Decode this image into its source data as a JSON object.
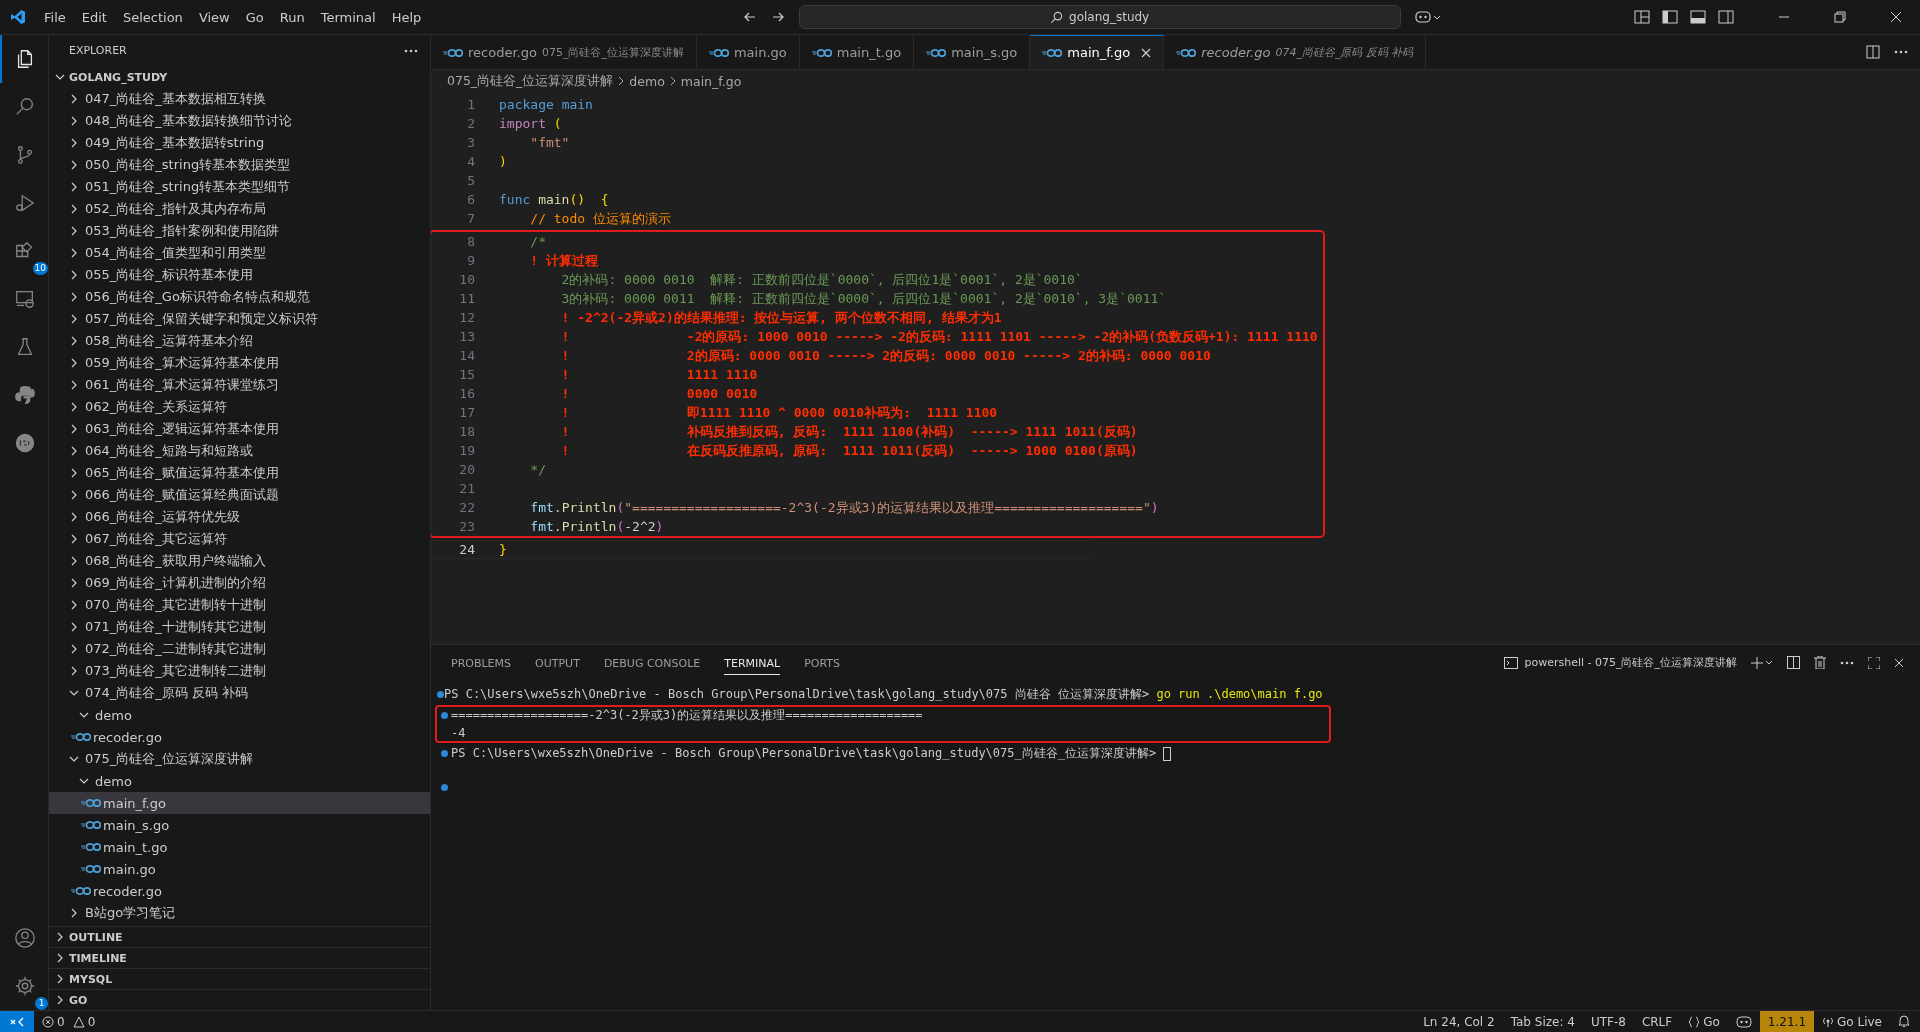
{
  "title_bar": {
    "menus": [
      "File",
      "Edit",
      "Selection",
      "View",
      "Go",
      "Run",
      "Terminal",
      "Help"
    ],
    "search": "golang_study"
  },
  "activity_bar": {
    "top": [
      {
        "kind": "explorer",
        "selected": true
      },
      {
        "kind": "search",
        "selected": false
      },
      {
        "kind": "source-control",
        "selected": false
      },
      {
        "kind": "run-debug",
        "selected": false
      },
      {
        "kind": "extensions",
        "selected": false,
        "badge": "10"
      },
      {
        "kind": "remote",
        "selected": false
      },
      {
        "kind": "testing",
        "selected": false
      },
      {
        "kind": "python",
        "selected": false
      },
      {
        "kind": "json",
        "selected": false
      }
    ],
    "bottom": [
      {
        "kind": "account"
      },
      {
        "kind": "settings",
        "badge": "1"
      }
    ]
  },
  "sidebar": {
    "title": "EXPLORER",
    "root": {
      "name": "GOLANG_STUDY",
      "expanded": true,
      "items": [
        {
          "name": "047_尚硅谷_基本数据相互转换",
          "kind": "folder",
          "expanded": false,
          "selected": false
        },
        {
          "name": "048_尚硅谷_基本数据转换细节讨论",
          "kind": "folder",
          "expanded": false,
          "selected": false
        },
        {
          "name": "049_尚硅谷_基本数据转string",
          "kind": "folder",
          "expanded": false,
          "selected": false
        },
        {
          "name": "050_尚硅谷_string转基本数据类型",
          "kind": "folder",
          "expanded": false,
          "selected": false
        },
        {
          "name": "051_尚硅谷_string转基本类型细节",
          "kind": "folder",
          "expanded": false,
          "selected": false
        },
        {
          "name": "052_尚硅谷_指针及其内存布局",
          "kind": "folder",
          "expanded": false,
          "selected": false
        },
        {
          "name": "053_尚硅谷_指针案例和使用陷阱",
          "kind": "folder",
          "expanded": false,
          "selected": false
        },
        {
          "name": "054_尚硅谷_值类型和引用类型",
          "kind": "folder",
          "expanded": false,
          "selected": false
        },
        {
          "name": "055_尚硅谷_标识符基本使用",
          "kind": "folder",
          "expanded": false,
          "selected": false
        },
        {
          "name": "056_尚硅谷_Go标识符命名特点和规范",
          "kind": "folder",
          "expanded": false,
          "selected": false
        },
        {
          "name": "057_尚硅谷_保留关键字和预定义标识符",
          "kind": "folder",
          "expanded": false,
          "selected": false
        },
        {
          "name": "058_尚硅谷_运算符基本介绍",
          "kind": "folder",
          "expanded": false,
          "selected": false
        },
        {
          "name": "059_尚硅谷_算术运算符基本使用",
          "kind": "folder",
          "expanded": false,
          "selected": false
        },
        {
          "name": "061_尚硅谷_算术运算符课堂练习",
          "kind": "folder",
          "expanded": false,
          "selected": false
        },
        {
          "name": "062_尚硅谷_关系运算符",
          "kind": "folder",
          "expanded": false,
          "selected": false
        },
        {
          "name": "063_尚硅谷_逻辑运算符基本使用",
          "kind": "folder",
          "expanded": false,
          "selected": false
        },
        {
          "name": "064_尚硅谷_短路与和短路或",
          "kind": "folder",
          "expanded": false,
          "selected": false
        },
        {
          "name": "065_尚硅谷_赋值运算符基本使用",
          "kind": "folder",
          "expanded": false,
          "selected": false
        },
        {
          "name": "066_尚硅谷_赋值运算经典面试题",
          "kind": "folder",
          "expanded": false,
          "selected": false
        },
        {
          "name": "066_尚硅谷_运算符优先级",
          "kind": "folder",
          "expanded": false,
          "selected": false
        },
        {
          "name": "067_尚硅谷_其它运算符",
          "kind": "folder",
          "expanded": false,
          "selected": false
        },
        {
          "name": "068_尚硅谷_获取用户终端输入",
          "kind": "folder",
          "expanded": false,
          "selected": false
        },
        {
          "name": "069_尚硅谷_计算机进制的介绍",
          "kind": "folder",
          "expanded": false,
          "selected": false
        },
        {
          "name": "070_尚硅谷_其它进制转十进制",
          "kind": "folder",
          "expanded": false,
          "selected": false
        },
        {
          "name": "071_尚硅谷_十进制转其它进制",
          "kind": "folder",
          "expanded": false,
          "selected": false
        },
        {
          "name": "072_尚硅谷_二进制转其它进制",
          "kind": "folder",
          "expanded": false,
          "selected": false
        },
        {
          "name": "073_尚硅谷_其它进制转二进制",
          "kind": "folder",
          "expanded": false,
          "selected": false
        },
        {
          "name": "074_尚硅谷_原码 反码 补码",
          "kind": "folder",
          "expanded": true,
          "selected": false,
          "children": [
            {
              "name": "demo",
              "kind": "folder",
              "expanded": true,
              "selected": false
            },
            {
              "name": "recoder.go",
              "kind": "file",
              "selected": false
            }
          ]
        },
        {
          "name": "075_尚硅谷_位运算深度讲解",
          "kind": "folder",
          "expanded": true,
          "selected": false,
          "children": [
            {
              "name": "demo",
              "kind": "folder",
              "expanded": true,
              "selected": false,
              "children": [
                {
                  "name": "main_f.go",
                  "kind": "file",
                  "selected": true
                },
                {
                  "name": "main_s.go",
                  "kind": "file",
                  "selected": false
                },
                {
                  "name": "main_t.go",
                  "kind": "file",
                  "selected": false
                },
                {
                  "name": "main.go",
                  "kind": "file",
                  "selected": false
                }
              ]
            },
            {
              "name": "recoder.go",
              "kind": "file",
              "selected": false
            }
          ]
        },
        {
          "name": "B站go学习笔记",
          "kind": "folder",
          "expanded": false,
          "selected": false
        }
      ]
    },
    "sections": [
      {
        "name": "OUTLINE",
        "expanded": false
      },
      {
        "name": "TIMELINE",
        "expanded": false
      },
      {
        "name": "MYSQL",
        "expanded": false
      },
      {
        "name": "GO",
        "expanded": false
      }
    ]
  },
  "tabs": [
    {
      "name": "recoder.go",
      "description": "075_尚硅谷_位运算深度讲解",
      "selected": false,
      "preview": false
    },
    {
      "name": "main.go",
      "selected": false,
      "preview": false
    },
    {
      "name": "main_t.go",
      "selected": false,
      "preview": false
    },
    {
      "name": "main_s.go",
      "selected": false,
      "preview": false
    },
    {
      "name": "main_f.go",
      "selected": true,
      "preview": false
    },
    {
      "name": "recoder.go",
      "description": "074_尚硅谷_原码 反码 补码",
      "selected": false,
      "preview": true
    }
  ],
  "breadcrumb": [
    "075_尚硅谷_位运算深度讲解",
    "demo",
    "main_f.go"
  ],
  "editor": {
    "blocks": [
      {
        "highlighted": false,
        "lines": [
          {
            "number": "1",
            "current": false,
            "segments": [
              {
                "text": "package ",
                "kind": "keyword"
              },
              {
                "text": "main",
                "kind": "keyword"
              }
            ]
          },
          {
            "number": "2",
            "current": false,
            "segments": [
              {
                "text": "import ",
                "kind": "control"
              },
              {
                "text": "(",
                "kind": "paren"
              }
            ]
          },
          {
            "number": "3",
            "current": false,
            "segments": [
              {
                "text": "    \"fmt\"",
                "kind": "string"
              }
            ]
          },
          {
            "number": "4",
            "current": false,
            "segments": [
              {
                "text": ")",
                "kind": "paren"
              }
            ]
          },
          {
            "number": "5",
            "current": false
          },
          {
            "number": "6",
            "current": false,
            "segments": [
              {
                "text": "func ",
                "kind": "keyword"
              },
              {
                "text": "main",
                "kind": "function"
              },
              {
                "text": "()  {",
                "kind": "paren"
              }
            ]
          },
          {
            "number": "7",
            "current": false,
            "segments": [
              {
                "text": "    // todo 位运算的演示",
                "kind": "todo"
              }
            ]
          }
        ]
      },
      {
        "highlighted": true,
        "lines": [
          {
            "number": "8",
            "current": false,
            "segments": [
              {
                "text": "    /*",
                "kind": "comment"
              }
            ]
          },
          {
            "number": "9",
            "current": false,
            "segments": [
              {
                "text": "    ! 计算过程",
                "kind": "alert"
              }
            ]
          },
          {
            "number": "10",
            "current": false,
            "segments": [
              {
                "text": "        2的补码: 0000 0010  解释: 正数前四位是`0000`, 后四位1是`0001`, 2是`0010`",
                "kind": "comment"
              }
            ]
          },
          {
            "number": "11",
            "current": false,
            "segments": [
              {
                "text": "        3的补码: 0000 0011  解释: 正数前四位是`0000`, 后四位1是`0001`, 2是`0010`, 3是`0011`",
                "kind": "comment"
              }
            ]
          },
          {
            "number": "12",
            "current": false,
            "segments": [
              {
                "text": "        ! -2^2(-2异或2)的结果推理: 按位与运算, 两个位数不相同, 结果才为1",
                "kind": "alert"
              }
            ]
          },
          {
            "number": "13",
            "current": false,
            "segments": [
              {
                "text": "        !               -2的原码: 1000 0010 -----> -2的反码: 1111 1101 -----> -2的补码(负数反码+1): 1111 1110",
                "kind": "alert"
              }
            ]
          },
          {
            "number": "14",
            "current": false,
            "segments": [
              {
                "text": "        !               2的原码: 0000 0010 -----> 2的反码: 0000 0010 -----> 2的补码: 0000 0010",
                "kind": "alert"
              }
            ]
          },
          {
            "number": "15",
            "current": false,
            "segments": [
              {
                "text": "        !               1111 1110",
                "kind": "alert"
              }
            ]
          },
          {
            "number": "16",
            "current": false,
            "segments": [
              {
                "text": "        !               0000 0010",
                "kind": "alert"
              }
            ]
          },
          {
            "number": "17",
            "current": false,
            "segments": [
              {
                "text": "        !               即1111 1110 ^ 0000 0010补码为:  1111 1100",
                "kind": "alert"
              }
            ]
          },
          {
            "number": "18",
            "current": false,
            "segments": [
              {
                "text": "        !               补码反推到反码, 反码:  1111 1100(补码)  -----> 1111 1011(反码)",
                "kind": "alert"
              }
            ]
          },
          {
            "number": "19",
            "current": false,
            "segments": [
              {
                "text": "        !               在反码反推原码, 原码:  1111 1011(反码)  -----> 1000 0100(原码)",
                "kind": "alert"
              }
            ]
          },
          {
            "number": "20",
            "current": false,
            "segments": [
              {
                "text": "    */",
                "kind": "comment"
              }
            ]
          },
          {
            "number": "21",
            "current": false
          },
          {
            "number": "22",
            "current": false,
            "segments": [
              {
                "text": "    fmt",
                "kind": "variable"
              },
              {
                "text": ".",
                "kind": "plain"
              },
              {
                "text": "Println",
                "kind": "function"
              },
              {
                "text": "(",
                "kind": "paren2"
              },
              {
                "text": "\"===================-2^3(-2异或3)的运算结果以及推理===================\"",
                "kind": "string"
              },
              {
                "text": ")",
                "kind": "paren2"
              }
            ]
          },
          {
            "number": "23",
            "current": false,
            "segments": [
              {
                "text": "    fmt",
                "kind": "variable"
              },
              {
                "text": ".",
                "kind": "plain"
              },
              {
                "text": "Println",
                "kind": "function"
              },
              {
                "text": "(",
                "kind": "paren2"
              },
              {
                "text": "-2^2",
                "kind": "plain"
              },
              {
                "text": ")",
                "kind": "paren2"
              }
            ]
          }
        ]
      },
      {
        "highlighted": false,
        "lines": [
          {
            "number": "24",
            "current": true,
            "segments": [
              {
                "text": "}",
                "kind": "paren"
              }
            ]
          }
        ]
      }
    ]
  },
  "panel": {
    "tabs": [
      {
        "label": "PROBLEMS",
        "selected": false
      },
      {
        "label": "OUTPUT",
        "selected": false
      },
      {
        "label": "DEBUG CONSOLE",
        "selected": false
      },
      {
        "label": "TERMINAL",
        "selected": true
      },
      {
        "label": "PORTS",
        "selected": false
      }
    ],
    "terminal_name": "powershell - 075_尚硅谷_位运算深度讲解",
    "blocks": [
      {
        "highlighted": false,
        "lines": [
          {
            "decorated": true,
            "segments": [
              {
                "text": "PS C:\\Users\\wxe5szh\\OneDrive - Bosch Group\\PersonalDrive\\task\\golang_study\\075 尚硅谷 位运算深度讲解> ",
                "kind": "plain"
              },
              {
                "text": "go run .\\demo\\main f.go",
                "kind": "command"
              }
            ]
          }
        ]
      },
      {
        "highlighted": true,
        "lines": [
          {
            "decorated": true,
            "segments": [
              {
                "text": "===================-2^3(-2异或3)的运算结果以及推理===================",
                "kind": "plain"
              }
            ]
          },
          {
            "segments": [
              {
                "text": "-4",
                "kind": "plain"
              }
            ]
          }
        ]
      },
      {
        "highlighted": false,
        "lines": [
          {
            "decorated": true,
            "cursor": true,
            "segments": [
              {
                "text": "PS C:\\Users\\wxe5szh\\OneDrive - Bosch Group\\PersonalDrive\\task\\golang_study\\075_尚硅谷_位运算深度讲解> ",
                "kind": "plain"
              }
            ]
          },
          {
            "decorated": true
          }
        ]
      }
    ]
  },
  "status_bar": {
    "errors": "0",
    "warnings": "0",
    "items": [
      {
        "kind": "text",
        "text": "Ln 24, Col 2"
      },
      {
        "kind": "text",
        "text": "Tab Size: 4"
      },
      {
        "kind": "text",
        "text": "UTF-8"
      },
      {
        "kind": "text",
        "text": "CRLF"
      },
      {
        "kind": "language",
        "text": "Go"
      },
      {
        "kind": "copilot"
      },
      {
        "kind": "version",
        "text": "1.21.1"
      },
      {
        "kind": "live",
        "text": "Go Live"
      },
      {
        "kind": "bell"
      }
    ]
  }
}
